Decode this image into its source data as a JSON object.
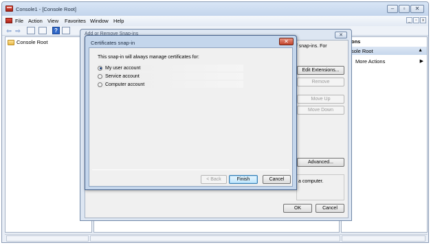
{
  "window": {
    "title": "Console1 - [Console Root]",
    "min_symbol": "–",
    "max_symbol": "▫",
    "close_symbol": "✕"
  },
  "menu": {
    "items": [
      "File",
      "Action",
      "View",
      "Favorites",
      "Window",
      "Help"
    ],
    "child_min": "_",
    "child_restore": "▫",
    "child_close": "x"
  },
  "toolbar": {
    "back": "⇦",
    "forward": "⇨",
    "help": "?"
  },
  "tree": {
    "root_label": "Console Root"
  },
  "actions": {
    "header": "ons",
    "section": "sole Root",
    "section_arrow": "▲",
    "more_actions": "More Actions",
    "more_arrow": "▶"
  },
  "add_remove_dialog": {
    "title": "Add or Remove Snap-ins",
    "close_symbol": "✕",
    "description": "of snap-ins. For",
    "description2": "a computer.",
    "buttons": {
      "edit_extensions": "Edit Extensions...",
      "remove": "Remove",
      "move_up": "Move Up",
      "move_down": "Move Down",
      "advanced": "Advanced...",
      "ok": "OK",
      "cancel": "Cancel"
    }
  },
  "cert_dialog": {
    "title": "Certificates snap-in",
    "close_symbol": "✕",
    "prompt": "This snap-in will always manage certificates for:",
    "options": [
      {
        "label": "My user account",
        "selected": true
      },
      {
        "label": "Service account",
        "selected": false
      },
      {
        "label": "Computer account",
        "selected": false
      }
    ],
    "buttons": {
      "back": "< Back",
      "finish": "Finish",
      "cancel": "Cancel"
    }
  }
}
